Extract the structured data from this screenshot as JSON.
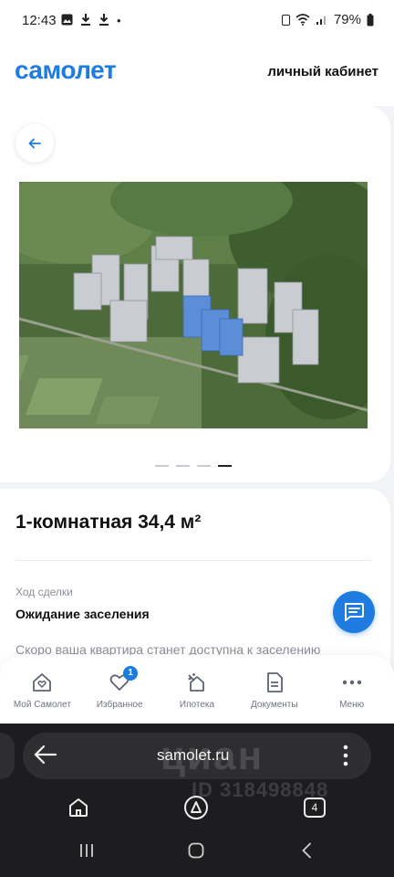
{
  "status_bar": {
    "time": "12:43",
    "battery": "79%"
  },
  "header": {
    "logo": "самолет",
    "cabinet_link": "личный кабинет"
  },
  "gallery": {
    "total": 4,
    "active_index": 3
  },
  "apartment": {
    "title": "1-комнатная 34,4 м²",
    "deal_label": "Ход сделки",
    "deal_status": "Ожидание заселения",
    "deal_note": "Скоро ваша квартира станет доступна к заселению"
  },
  "bottom_nav": {
    "items": [
      {
        "label": "Мой Самолет",
        "icon": "home-heart-icon"
      },
      {
        "label": "Избранное",
        "icon": "heart-icon",
        "badge": "1"
      },
      {
        "label": "Ипотека",
        "icon": "mortgage-icon"
      },
      {
        "label": "Документы",
        "icon": "document-icon"
      },
      {
        "label": "Меню",
        "icon": "more-icon"
      }
    ]
  },
  "browser": {
    "url": "samolet.ru",
    "tab_count": "4"
  },
  "watermark": {
    "brand": "циан",
    "listing_id": "ID 318498848"
  },
  "colors": {
    "accent": "#1e7be0",
    "background": "#f2f3f7",
    "browser": "#1d1d1f"
  }
}
